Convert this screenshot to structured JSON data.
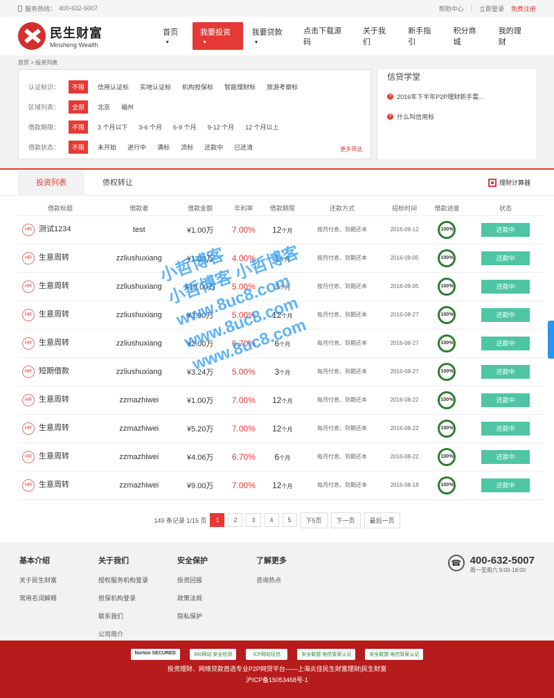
{
  "top": {
    "hotline_label": "服务热线：",
    "hotline": "400-632-5007",
    "help": "帮助中心",
    "login": "立即登录",
    "register": "免费注册"
  },
  "logo": {
    "cn": "民生财富",
    "en": "Minsheng Wealth"
  },
  "nav": [
    "首页",
    "我要投资",
    "我要贷款",
    "点击下载源码",
    "关于我们",
    "新手指引",
    "积分商城",
    "我的理财"
  ],
  "breadcrumb": "首页 > 投资列表",
  "filters": [
    {
      "label": "认证标识：",
      "options": [
        "不限",
        "信用认证标",
        "实地认证标",
        "机构担保标",
        "智能理财标",
        "旅游考察标"
      ]
    },
    {
      "label": "区域列表：",
      "options": [
        "全部",
        "北京",
        "福州"
      ]
    },
    {
      "label": "借款期限：",
      "options": [
        "不限",
        "3 个月以下",
        "3-6 个月",
        "6-9 个月",
        "9-12 个月",
        "12 个月以上"
      ]
    },
    {
      "label": "借款状态：",
      "options": [
        "不限",
        "未开始",
        "进行中",
        "满标",
        "流标",
        "还款中",
        "已还清"
      ]
    }
  ],
  "more_filter": "更多筛选",
  "school": {
    "title": "信贷学堂",
    "items": [
      "2016年下半年P2P理财新手需...",
      "什么叫信用标"
    ]
  },
  "tabs": [
    "投资列表",
    "债权转让"
  ],
  "calc": "理财计算器",
  "table": {
    "headers": [
      "借款标题",
      "借款者",
      "借款金额",
      "年利率",
      "借款期限",
      "还款方式",
      "招标时间",
      "借款进度",
      "状态"
    ],
    "rows": [
      [
        "测试1234",
        "test",
        "¥1.00万",
        "7.00%",
        "12",
        "按月付息、到期还本",
        "2016-09-12",
        "100%",
        "还款中"
      ],
      [
        "生意周转",
        "zzliushuxiang",
        "¥1.03万",
        "4.00%",
        "1",
        "按月付息、到期还本",
        "2016-09-05",
        "100%",
        "还款中"
      ],
      [
        "生意周转",
        "zzliushuxiang",
        "¥18.00万",
        "5.00%",
        "3",
        "按月付息、到期还本",
        "2016-09-05",
        "100%",
        "还款中"
      ],
      [
        "生意周转",
        "zzliushuxiang",
        "¥3.00万",
        "5.00%",
        "12",
        "每月付息、到期还本",
        "2016-08-27",
        "100%",
        "还款中"
      ],
      [
        "生意周转",
        "zzliushuxiang",
        "¥2.00万",
        "6.70%",
        "6",
        "每月付息、到期还本",
        "2016-08-27",
        "100%",
        "还款中"
      ],
      [
        "短期借款",
        "zzliushuxiang",
        "¥3.24万",
        "5.00%",
        "3",
        "每月付息、到期还本",
        "2016-08-27",
        "100%",
        "还款中"
      ],
      [
        "生意周转",
        "zzmazhiwei",
        "¥1.00万",
        "7.00%",
        "12",
        "每月付息、到期还本",
        "2016-08-22",
        "100%",
        "还款中"
      ],
      [
        "生意周转",
        "zzmazhiwei",
        "¥5.20万",
        "7.00%",
        "12",
        "每月付息、到期还本",
        "2016-08-22",
        "100%",
        "还款中"
      ],
      [
        "生意周转",
        "zzmazhiwei",
        "¥4.06万",
        "6.70%",
        "6",
        "每月付息、到期还本",
        "2016-08-22",
        "100%",
        "还款中"
      ],
      [
        "生意周转",
        "zzmazhiwei",
        "¥9.00万",
        "7.00%",
        "12",
        "每月付息、到期还本",
        "2016-08-18",
        "100%",
        "还款中"
      ]
    ]
  },
  "pager": {
    "info": "149 条记录 1/15 页",
    "pages": [
      "1",
      "2",
      "3",
      "4",
      "5",
      "下5页",
      "下一页",
      "最后一页"
    ]
  },
  "footer": {
    "cols": [
      {
        "title": "基本介绍",
        "links": [
          "关于民生财富",
          "常用名词解释"
        ]
      },
      {
        "title": "关于我们",
        "links": [
          "授权服务机构登录",
          "担保机构登录",
          "联系我们",
          "公司简介"
        ]
      },
      {
        "title": "安全保护",
        "links": [
          "投资回报",
          "政策法规",
          "隐私保护"
        ]
      },
      {
        "title": "了解更多",
        "links": [
          "咨询热点"
        ]
      }
    ],
    "tel": "400-632-5007",
    "hours": "周一至周六 9:00-18:00"
  },
  "bottom": {
    "badges": [
      "Norton SECURED",
      "360网站 安全检测",
      "ICP网站征信",
      "安全联盟 电信管家认证",
      "安全联盟 电信管家认证"
    ],
    "copy": "投资理财、网络贷款首选专业P2P网贷平台——上海炎佳民生财富理财|民生财富",
    "icp": "沪ICP备15053468号-1"
  },
  "watermark": [
    "小哲博客",
    "小哲博客 小哲博客",
    "www.8uc8.com",
    "www.8uc8.com",
    "www.8uc8.com"
  ]
}
